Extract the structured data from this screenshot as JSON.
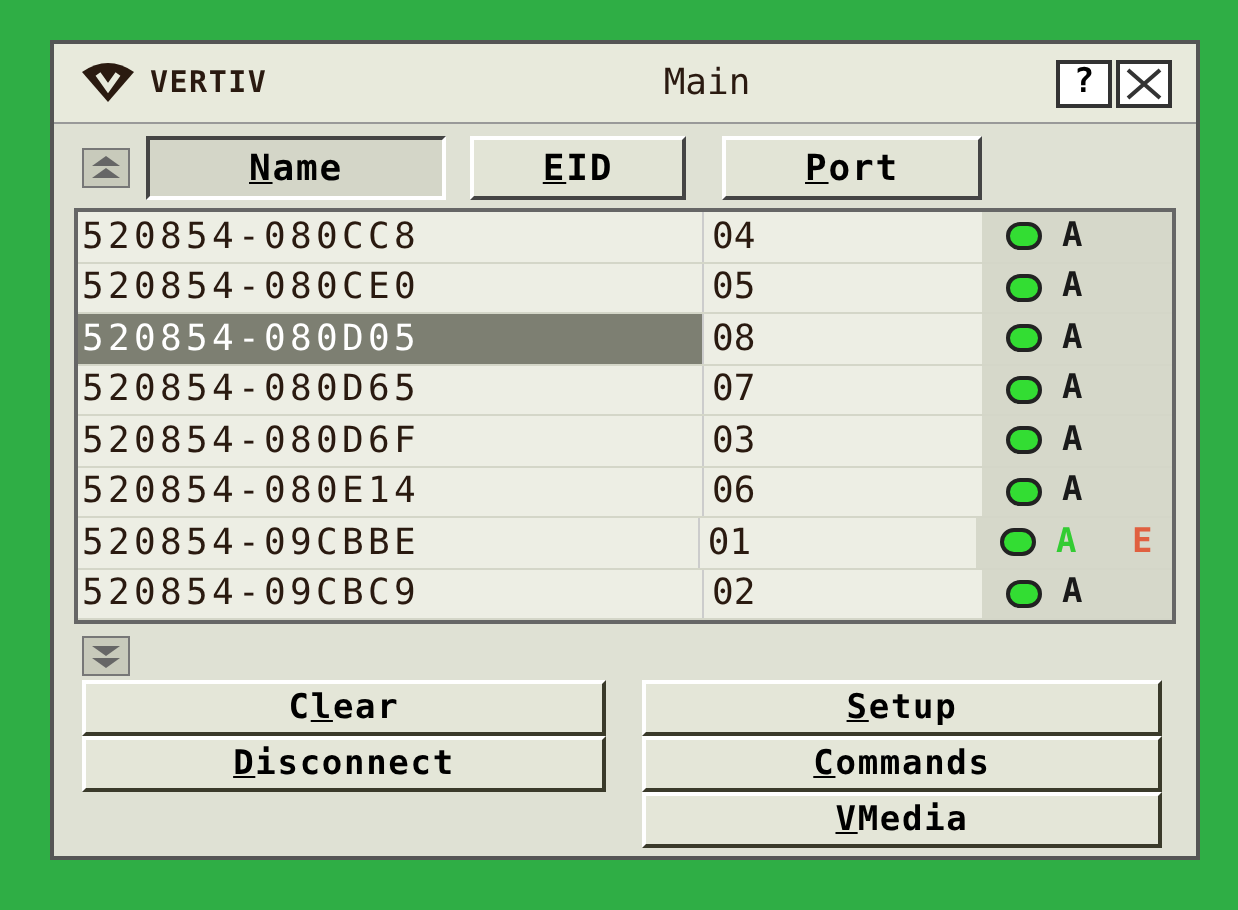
{
  "window": {
    "logo": "VERTIV",
    "title": "Main",
    "help": "?"
  },
  "columns": [
    {
      "label": [
        {
          "text": "N",
          "underlined": true
        },
        {
          "text": "ame",
          "underlined": false
        }
      ],
      "selected": true
    },
    {
      "label": [
        {
          "text": "E",
          "underlined": true
        },
        {
          "text": "ID",
          "underlined": false
        }
      ],
      "selected": false
    },
    {
      "label": [
        {
          "text": "P",
          "underlined": true
        },
        {
          "text": "ort",
          "underlined": false
        }
      ],
      "selected": false
    }
  ],
  "rows": [
    {
      "name": "520854-080CC8",
      "port": "04",
      "selected": false,
      "flags": [
        {
          "text": "A",
          "color": "#1a1a1a"
        }
      ]
    },
    {
      "name": "520854-080CE0",
      "port": "05",
      "selected": false,
      "flags": [
        {
          "text": "A",
          "color": "#1a1a1a"
        }
      ]
    },
    {
      "name": "520854-080D05",
      "port": "08",
      "selected": true,
      "flags": [
        {
          "text": "A",
          "color": "#1a1a1a"
        }
      ]
    },
    {
      "name": "520854-080D65",
      "port": "07",
      "selected": false,
      "flags": [
        {
          "text": "A",
          "color": "#1a1a1a"
        }
      ]
    },
    {
      "name": "520854-080D6F",
      "port": "03",
      "selected": false,
      "flags": [
        {
          "text": "A",
          "color": "#1a1a1a"
        }
      ]
    },
    {
      "name": "520854-080E14",
      "port": "06",
      "selected": false,
      "flags": [
        {
          "text": "A",
          "color": "#1a1a1a"
        }
      ]
    },
    {
      "name": "520854-09CBBE",
      "port": "01",
      "selected": false,
      "flags": [
        {
          "text": "A",
          "color": "#33cc33"
        },
        {
          "text": "E",
          "color": "#e06040"
        }
      ]
    },
    {
      "name": "520854-09CBC9",
      "port": "02",
      "selected": false,
      "flags": [
        {
          "text": "A",
          "color": "#1a1a1a"
        }
      ]
    }
  ],
  "left_buttons": [
    {
      "label": [
        {
          "text": "C",
          "underlined": false
        },
        {
          "text": "l",
          "underlined": true
        },
        {
          "text": "ear",
          "underlined": false
        }
      ]
    },
    {
      "label": [
        {
          "text": "D",
          "underlined": true
        },
        {
          "text": "isconnect",
          "underlined": false
        }
      ]
    }
  ],
  "right_buttons": [
    {
      "label": [
        {
          "text": "S",
          "underlined": true
        },
        {
          "text": "etup",
          "underlined": false
        }
      ]
    },
    {
      "label": [
        {
          "text": "C",
          "underlined": true
        },
        {
          "text": "ommands",
          "underlined": false
        }
      ]
    },
    {
      "label": [
        {
          "text": "V",
          "underlined": true
        },
        {
          "text": "Media",
          "underlined": false
        }
      ]
    }
  ]
}
